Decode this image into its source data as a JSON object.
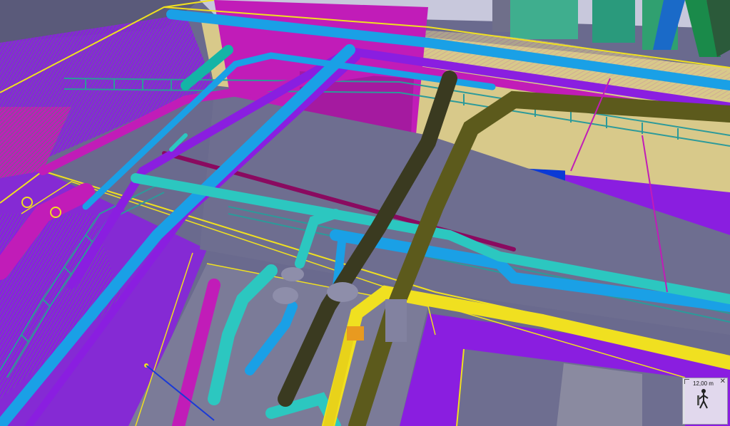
{
  "viewport": {
    "background": "#6a6a8e",
    "colors": {
      "magenta": "#c11cb8",
      "violet": "#8a1ee0",
      "blue_pipe": "#1aa0e6",
      "cyan_pipe": "#2cc7c0",
      "teal": "#14b4a6",
      "yellow": "#f0e020",
      "olive": "#5c5a1c",
      "beige_wall": "#d8c98a",
      "blue_panel": "#0b3ad6",
      "steel": "#747494"
    }
  },
  "nav_widget": {
    "distance_label": "12,00 m",
    "close_icon": "close-icon",
    "figure_icon": "walking-person-icon"
  }
}
